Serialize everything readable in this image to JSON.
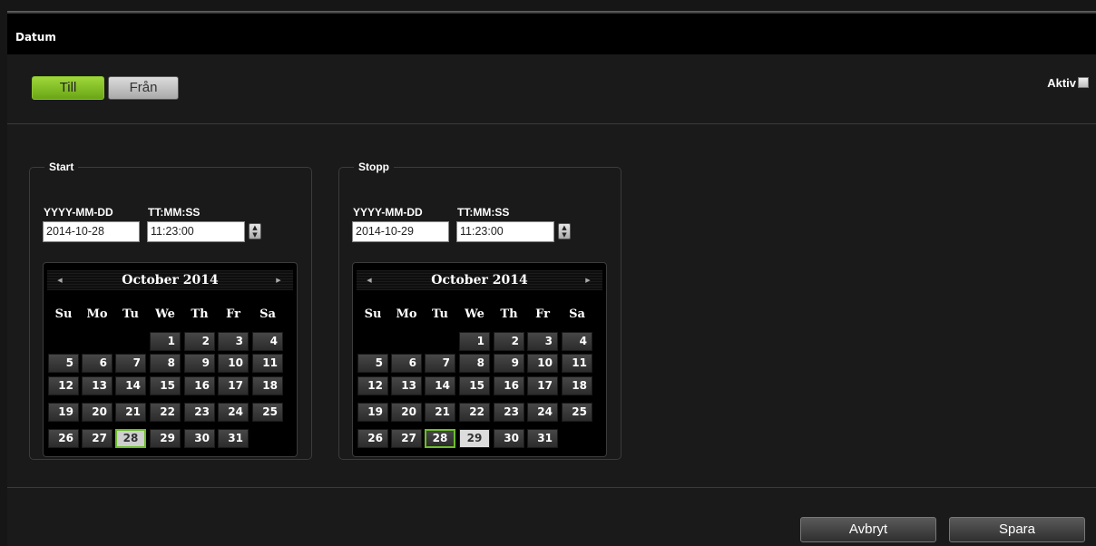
{
  "window": {
    "title": "Datum"
  },
  "toggle": {
    "till_label": "Till",
    "fran_label": "Från"
  },
  "aktiv": {
    "label": "Aktiv",
    "checked": false
  },
  "start": {
    "legend": "Start",
    "date_label": "YYYY-MM-DD",
    "time_label": "TT:MM:SS",
    "date_value": "2014-10-28",
    "time_value": "11:23:00",
    "calendar": {
      "month_label": "October 2014",
      "weekdays": [
        "Su",
        "Mo",
        "Tu",
        "We",
        "Th",
        "Fr",
        "Sa"
      ],
      "first_weekday": 3,
      "days_in_month": 31,
      "today": 28,
      "selected": 28
    }
  },
  "stopp": {
    "legend": "Stopp",
    "date_label": "YYYY-MM-DD",
    "time_label": "TT:MM:SS",
    "date_value": "2014-10-29",
    "time_value": "11:23:00",
    "calendar": {
      "month_label": "October 2014",
      "weekdays": [
        "Su",
        "Mo",
        "Tu",
        "We",
        "Th",
        "Fr",
        "Sa"
      ],
      "first_weekday": 3,
      "days_in_month": 31,
      "today": 28,
      "selected": 29
    }
  },
  "footer": {
    "cancel_label": "Avbryt",
    "save_label": "Spara"
  },
  "colors": {
    "accent_green": "#8bc22c",
    "today_border": "#6cbd2c",
    "background": "#1a1a1a"
  }
}
